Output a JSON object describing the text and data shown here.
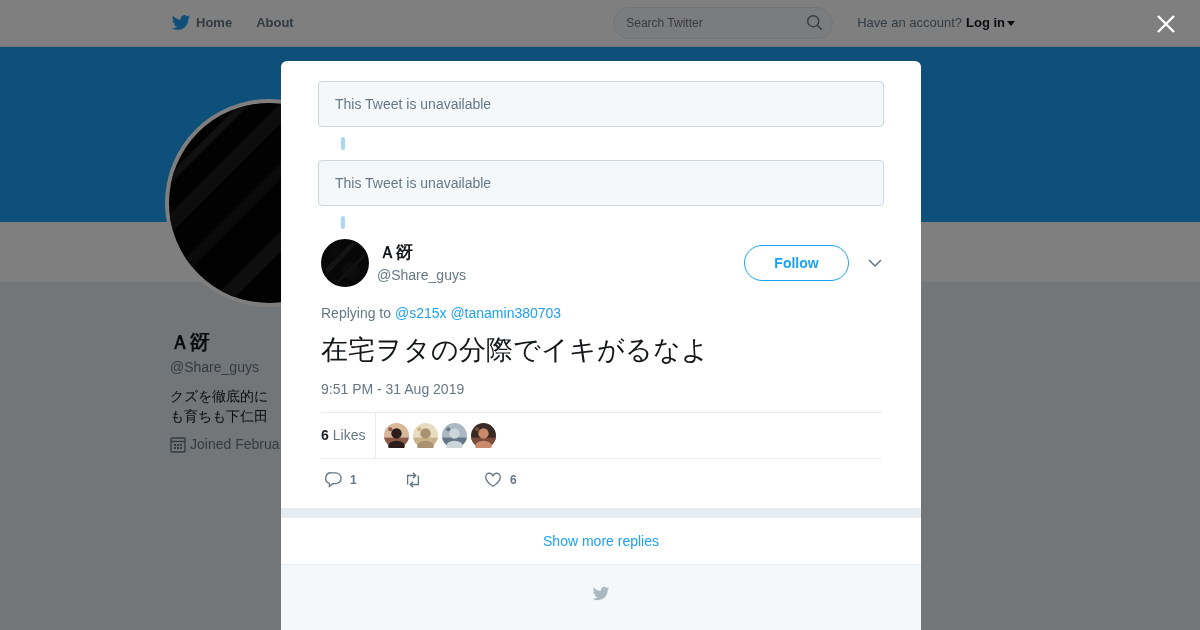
{
  "header": {
    "nav": [
      {
        "label": "Home",
        "kind": "logo"
      },
      {
        "label": "About",
        "kind": "plain"
      }
    ],
    "search": {
      "placeholder": "Search Twitter"
    },
    "account": {
      "prompt": "Have an account?",
      "link": "Log in"
    }
  },
  "profile": {
    "name": "Ａ谺",
    "handle": "@Share_guys",
    "bio_lines": [
      "クズを徹底的に",
      "も育ちも下仁田"
    ],
    "joined": "Joined Februa"
  },
  "modal": {
    "unavailable": [
      "This Tweet is unavailable",
      "This Tweet is unavailable"
    ],
    "tweet": {
      "name": "Ａ谺",
      "handle": "@Share_guys",
      "follow": "Follow",
      "replying_label": "Replying to",
      "mentions": [
        "@s215x",
        "@tanamin380703"
      ],
      "text": "在宅ヲタの分際でイキがるなよ",
      "time": "9:51 PM - 31 Aug 2019",
      "likes_count": "6",
      "likes_label": "Likes",
      "likers": [
        {
          "kind": "picture"
        },
        {
          "kind": "picture"
        },
        {
          "kind": "picture"
        },
        {
          "kind": "picture"
        }
      ],
      "actions": [
        {
          "kind": "reply",
          "count": "1"
        },
        {
          "kind": "retweet"
        },
        {
          "kind": "like",
          "count": "6"
        }
      ]
    },
    "show_more": "Show more replies"
  }
}
